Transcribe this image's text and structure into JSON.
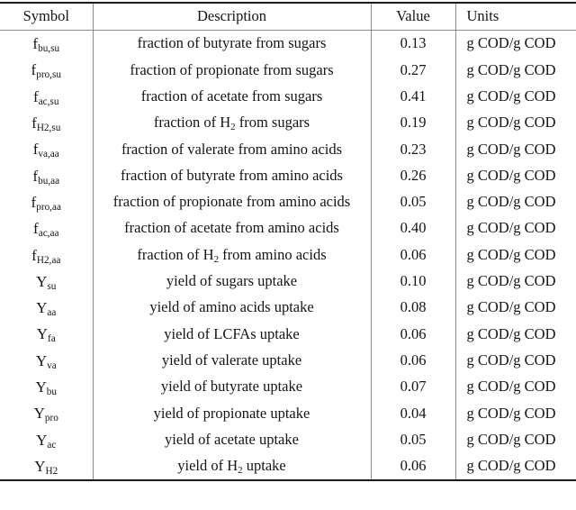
{
  "table": {
    "columns": [
      {
        "key": "symbol",
        "label": "Symbol"
      },
      {
        "key": "description",
        "label": "Description"
      },
      {
        "key": "value",
        "label": "Value"
      },
      {
        "key": "units",
        "label": "Units"
      }
    ],
    "rows": [
      {
        "symbol_base": "f",
        "symbol_sub": "bu,su",
        "description_pre": "fraction of butyrate from sugars",
        "description_sub": "",
        "description_post": "",
        "value": "0.13",
        "units": "g COD/g COD"
      },
      {
        "symbol_base": "f",
        "symbol_sub": "pro,su",
        "description_pre": "fraction of propionate from sugars",
        "description_sub": "",
        "description_post": "",
        "value": "0.27",
        "units": "g COD/g COD"
      },
      {
        "symbol_base": "f",
        "symbol_sub": "ac,su",
        "description_pre": "fraction of acetate from sugars",
        "description_sub": "",
        "description_post": "",
        "value": "0.41",
        "units": "g COD/g COD"
      },
      {
        "symbol_base": "f",
        "symbol_sub": "H2,su",
        "description_pre": "fraction of H",
        "description_sub": "2",
        "description_post": " from sugars",
        "value": "0.19",
        "units": "g COD/g COD"
      },
      {
        "symbol_base": "f",
        "symbol_sub": "va,aa",
        "description_pre": "fraction of valerate from amino acids",
        "description_sub": "",
        "description_post": "",
        "value": "0.23",
        "units": "g COD/g COD"
      },
      {
        "symbol_base": "f",
        "symbol_sub": "bu,aa",
        "description_pre": "fraction of butyrate from amino acids",
        "description_sub": "",
        "description_post": "",
        "value": "0.26",
        "units": "g COD/g COD"
      },
      {
        "symbol_base": "f",
        "symbol_sub": "pro,aa",
        "description_pre": "fraction of propionate from amino acids",
        "description_sub": "",
        "description_post": "",
        "value": "0.05",
        "units": "g COD/g COD"
      },
      {
        "symbol_base": "f",
        "symbol_sub": "ac,aa",
        "description_pre": "fraction of acetate from amino acids",
        "description_sub": "",
        "description_post": "",
        "value": "0.40",
        "units": "g COD/g COD"
      },
      {
        "symbol_base": "f",
        "symbol_sub": "H2,aa",
        "description_pre": "fraction of H",
        "description_sub": "2",
        "description_post": " from amino acids",
        "value": "0.06",
        "units": "g COD/g COD"
      },
      {
        "symbol_base": "Y",
        "symbol_sub": "su",
        "description_pre": "yield of sugars uptake",
        "description_sub": "",
        "description_post": "",
        "value": "0.10",
        "units": "g COD/g COD"
      },
      {
        "symbol_base": "Y",
        "symbol_sub": "aa",
        "description_pre": "yield of amino acids uptake",
        "description_sub": "",
        "description_post": "",
        "value": "0.08",
        "units": "g COD/g COD"
      },
      {
        "symbol_base": "Y",
        "symbol_sub": "fa",
        "description_pre": "yield of LCFAs uptake",
        "description_sub": "",
        "description_post": "",
        "value": "0.06",
        "units": "g COD/g COD"
      },
      {
        "symbol_base": "Y",
        "symbol_sub": "va",
        "description_pre": "yield of valerate uptake",
        "description_sub": "",
        "description_post": "",
        "value": "0.06",
        "units": "g COD/g COD"
      },
      {
        "symbol_base": "Y",
        "symbol_sub": "bu",
        "description_pre": "yield of butyrate uptake",
        "description_sub": "",
        "description_post": "",
        "value": "0.07",
        "units": "g COD/g COD"
      },
      {
        "symbol_base": "Y",
        "symbol_sub": "pro",
        "description_pre": "yield of propionate uptake",
        "description_sub": "",
        "description_post": "",
        "value": "0.04",
        "units": "g COD/g COD"
      },
      {
        "symbol_base": "Y",
        "symbol_sub": "ac",
        "description_pre": "yield of acetate uptake",
        "description_sub": "",
        "description_post": "",
        "value": "0.05",
        "units": "g COD/g COD"
      },
      {
        "symbol_base": "Y",
        "symbol_sub": "H2",
        "description_pre": "yield of H",
        "description_sub": "2",
        "description_post": " uptake",
        "value": "0.06",
        "units": "g COD/g COD"
      }
    ]
  }
}
